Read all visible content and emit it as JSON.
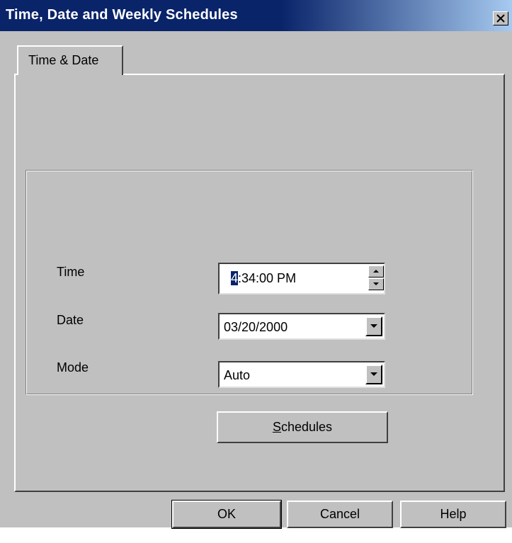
{
  "window": {
    "title": "Time, Date and Weekly Schedules"
  },
  "tabs": [
    {
      "label": "Time & Date"
    }
  ],
  "form": {
    "time": {
      "label": "Time",
      "value_selected": "4",
      "value_rest": ":34:00 PM"
    },
    "date": {
      "label": "Date",
      "value": "03/20/2000"
    },
    "mode": {
      "label": "Mode",
      "value": "Auto"
    },
    "schedules_button": {
      "label_mnemonic": "S",
      "label_rest": "chedules"
    }
  },
  "buttons": {
    "ok": "OK",
    "cancel": "Cancel",
    "help": "Help"
  },
  "colors": {
    "titlebar_start": "#0a246a",
    "titlebar_end": "#a6caf0",
    "face": "#c0c0c0"
  },
  "icons": {
    "close": "close-icon",
    "spin_up": "arrow-up-icon",
    "spin_down": "arrow-down-icon",
    "dropdown": "chevron-down-icon"
  }
}
